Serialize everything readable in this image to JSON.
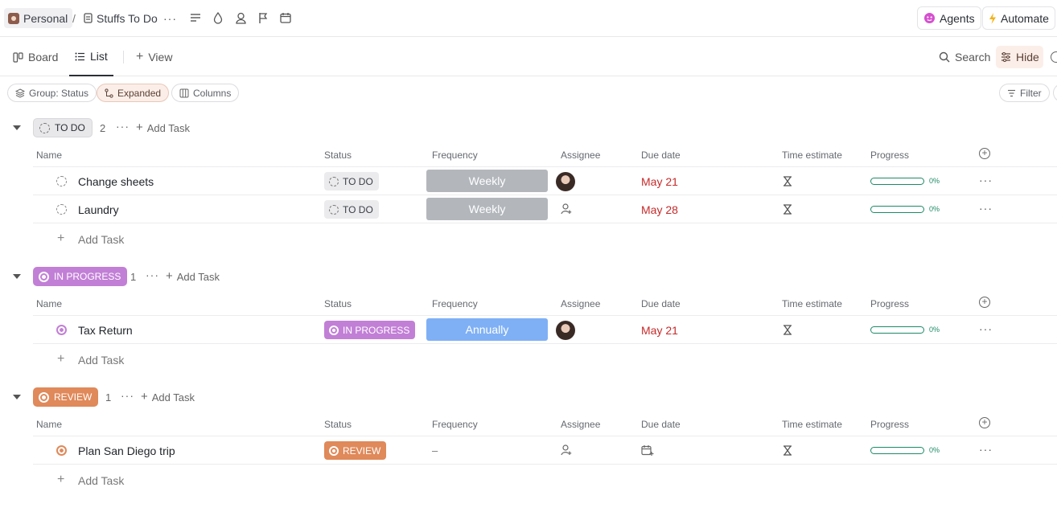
{
  "header": {
    "workspace": "Personal",
    "separator": "/",
    "list_name": "Stuffs To Do",
    "more": "···",
    "agents_label": "Agents",
    "automate_label": "Automate"
  },
  "views": {
    "board_label": "Board",
    "list_label": "List",
    "add_view_label": "View",
    "search_label": "Search",
    "hide_label": "Hide"
  },
  "filters": {
    "group_label": "Group: Status",
    "expanded_label": "Expanded",
    "columns_label": "Columns",
    "filter_label": "Filter"
  },
  "columns": [
    "Name",
    "Status",
    "Frequency",
    "Assignee",
    "Due date",
    "Time estimate",
    "Progress"
  ],
  "add_task_label": "Add Task",
  "groups": [
    {
      "status": "TO DO",
      "count": "2",
      "color": "#e8e8ea",
      "tasks": [
        {
          "name": "Change sheets",
          "status": "TO DO",
          "frequency": "Weekly",
          "due": "May 21",
          "progress": "0%"
        },
        {
          "name": "Laundry",
          "status": "TO DO",
          "frequency": "Weekly",
          "due": "May 28",
          "progress": "0%"
        }
      ]
    },
    {
      "status": "IN PROGRESS",
      "count": "1",
      "color": "#c27fd6",
      "tasks": [
        {
          "name": "Tax Return",
          "status": "IN PROGRESS",
          "frequency": "Annually",
          "due": "May 21",
          "progress": "0%"
        }
      ]
    },
    {
      "status": "REVIEW",
      "count": "1",
      "color": "#e0895a",
      "tasks": [
        {
          "name": "Plan San Diego trip",
          "status": "REVIEW",
          "frequency": "–",
          "due": "",
          "progress": "0%"
        }
      ]
    }
  ],
  "colors": {
    "weekly_bg": "#b3b7bc",
    "annually_bg": "#7fb0f5",
    "due_red": "#c62a2a",
    "progress_green": "#1c8a67"
  }
}
